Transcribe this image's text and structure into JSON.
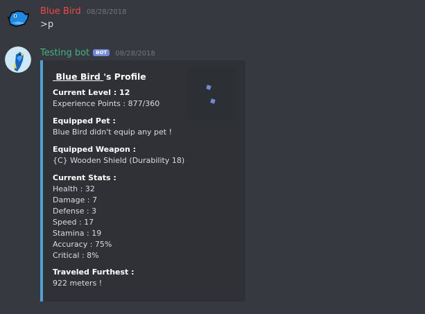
{
  "messages": [
    {
      "username": "Blue Bird",
      "username_color": "#f04747",
      "timestamp": "08/28/2018",
      "content": ">p"
    },
    {
      "username": "Testing bot",
      "username_color": "#43b581",
      "bot_tag": "BOT",
      "timestamp": "08/28/2018",
      "embed": {
        "title_link": "Blue Bird",
        "title_suffix": "'s Profile",
        "accent_color": "#4e9fd6",
        "fields": [
          {
            "name": "Current Level : 12",
            "values": [
              "Experience Points : 877/360"
            ]
          },
          {
            "name": "Equipped Pet :",
            "values": [
              "Blue Bird didn't equip any pet !"
            ]
          },
          {
            "name": "Equipped Weapon :",
            "values": [
              "{C} Wooden Shield (Durability 18)"
            ]
          },
          {
            "name": "Current Stats :",
            "values": [
              "Health : 32",
              "Damage : 7",
              "Defense : 3",
              "Speed : 17",
              "Stamina : 19",
              "Accuracy : 75%",
              "Critical : 8%"
            ]
          },
          {
            "name": "Traveled Furthest :",
            "values": [
              "922 meters !"
            ]
          }
        ]
      }
    }
  ],
  "icons": {
    "user_avatar": "blue-bird-pixel-avatar",
    "bot_avatar": "blue-parrot-avatar",
    "thumbnail": "profile-thumbnail"
  }
}
